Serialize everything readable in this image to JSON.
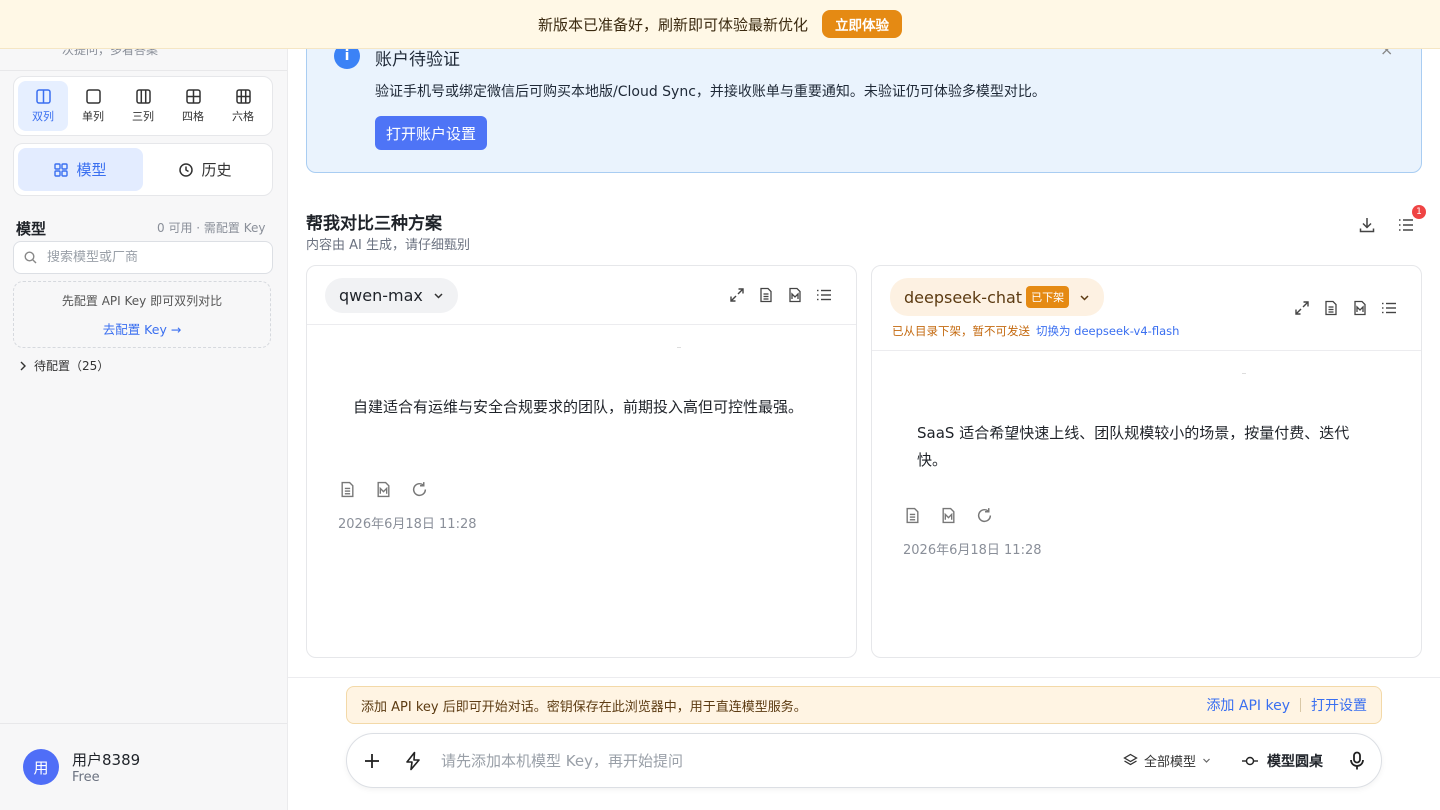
{
  "banner": {
    "message": "新版本已准备好，刷新即可体验最新优化",
    "button": "立即体验"
  },
  "sidebar": {
    "hint": "次提问，多看答案",
    "layouts": [
      {
        "label": "双列",
        "icon": "two-column-icon",
        "active": true
      },
      {
        "label": "单列",
        "icon": "single-column-icon",
        "active": false
      },
      {
        "label": "三列",
        "icon": "three-column-icon",
        "active": false
      },
      {
        "label": "四格",
        "icon": "four-grid-icon",
        "active": false
      },
      {
        "label": "六格",
        "icon": "six-grid-icon",
        "active": false
      }
    ],
    "tabs": [
      {
        "label": "模型",
        "icon": "grid-icon",
        "active": true
      },
      {
        "label": "历史",
        "icon": "clock-icon",
        "active": false
      }
    ],
    "models_title": "模型",
    "models_meta": "0 可用 · 需配置 Key",
    "search_placeholder": "搜索模型或厂商",
    "api_hint": "先配置 API Key 即可双列对比",
    "api_link": "去配置 Key →",
    "pending": "待配置（25）",
    "user": {
      "avatar": "用",
      "name": "用户8389",
      "plan": "Free"
    }
  },
  "alert": {
    "title": "账户待验证",
    "body": "验证手机号或绑定微信后可购买本地版/Cloud Sync，并接收账单与重要通知。未验证仍可体验多模型对比。",
    "button": "打开账户设置",
    "close": "×"
  },
  "conversation": {
    "title": "帮我对比三种方案",
    "subtitle": "内容由 AI 生成，请仔细甄别",
    "badge": "1"
  },
  "panels": [
    {
      "model": "qwen-max",
      "response": "自建适合有运维与安全合规要求的团队，前期投入高但可控性最强。",
      "timestamp": "2026年6月18日 11:28"
    },
    {
      "model": "deepseek-chat",
      "tag": "已下架",
      "note": "已从目录下架，暂不可发送",
      "switch_link": "切换为 deepseek-v4-flash",
      "response": "SaaS 适合希望快速上线、团队规模较小的场景，按量付费、迭代快。",
      "timestamp": "2026年6月18日 11:28"
    }
  ],
  "apibar": {
    "message": "添加 API key 后即可开始对话。密钥保存在此浏览器中，用于直连模型服务。",
    "add_key": "添加 API key",
    "open_settings": "打开设置"
  },
  "composer": {
    "placeholder": "请先添加本机模型 Key，再开始提问",
    "model_select": "全部模型",
    "roundtable": "模型圆桌"
  },
  "colors": {
    "accent": "#4e74f6",
    "warning": "#e58a13",
    "alert_bg": "#eaf3fd"
  }
}
